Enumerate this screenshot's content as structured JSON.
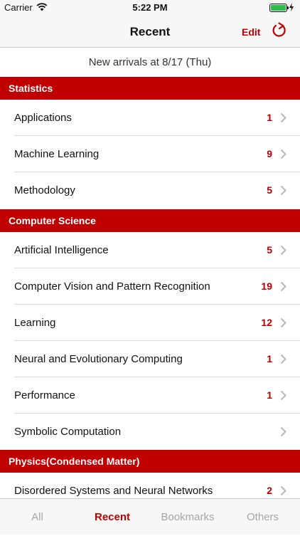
{
  "status_bar": {
    "carrier": "Carrier",
    "time": "5:22 PM"
  },
  "nav": {
    "title": "Recent",
    "edit_label": "Edit",
    "refresh_icon": "refresh-icon"
  },
  "arrivals_text": "New arrivals at 8/17 (Thu)",
  "sections": [
    {
      "title": "Statistics",
      "items": [
        {
          "label": "Applications",
          "count": "1"
        },
        {
          "label": "Machine Learning",
          "count": "9"
        },
        {
          "label": "Methodology",
          "count": "5"
        }
      ]
    },
    {
      "title": "Computer Science",
      "items": [
        {
          "label": "Artificial Intelligence",
          "count": "5"
        },
        {
          "label": "Computer Vision and Pattern Recognition",
          "count": "19"
        },
        {
          "label": "Learning",
          "count": "12"
        },
        {
          "label": "Neural and Evolutionary Computing",
          "count": "1"
        },
        {
          "label": "Performance",
          "count": "1"
        },
        {
          "label": "Symbolic Computation",
          "count": ""
        }
      ]
    },
    {
      "title": "Physics(Condensed Matter)",
      "items": [
        {
          "label": "Disordered Systems and Neural Networks",
          "count": "2"
        }
      ]
    }
  ],
  "tabs": [
    {
      "label": "All",
      "active": false
    },
    {
      "label": "Recent",
      "active": true
    },
    {
      "label": "Bookmarks",
      "active": false
    },
    {
      "label": "Others",
      "active": false
    }
  ],
  "colors": {
    "accent": "#c00000",
    "count": "#b00000",
    "battery": "#2dbe4c"
  }
}
